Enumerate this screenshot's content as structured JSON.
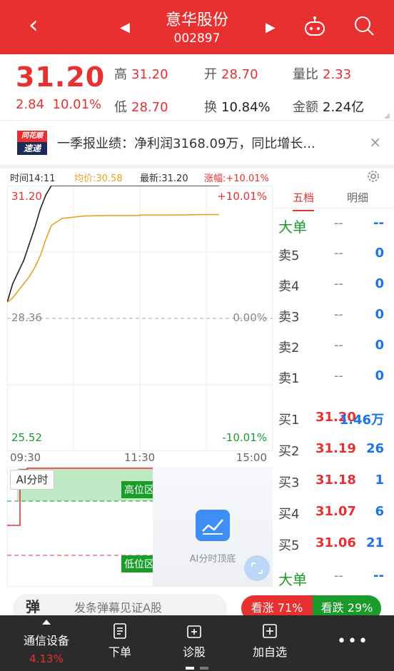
{
  "header": {
    "back_icon": "chevron-left-icon",
    "prev_icon": "triangle-left-icon",
    "next_icon": "triangle-right-icon",
    "stock_name": "意华股份",
    "stock_code": "002897",
    "robot_icon": "robot-icon",
    "search_icon": "search-icon",
    "bg_color": "#e93030"
  },
  "quote": {
    "price": "31.20",
    "change": "2.84",
    "change_pct": "10.01%",
    "high_label": "高",
    "high": "31.20",
    "open_label": "开",
    "open": "28.70",
    "vol_ratio_label": "量比",
    "vol_ratio": "2.33",
    "low_label": "低",
    "low": "28.70",
    "turnover_label": "换",
    "turnover": "10.84%",
    "amount_label": "金额",
    "amount": "2.24亿"
  },
  "news": {
    "logo_top": "同花顺",
    "logo_bottom": "速递",
    "text": "一季报业绩：净利润3168.09万，同比增长...",
    "close": "×"
  },
  "chart_info": {
    "time": "时间14:11",
    "avg": "均价:30.58",
    "latest": "最新:31.20",
    "change": "涨幅:+10.01%",
    "settings_icon": "gear-icon"
  },
  "chart_labels": {
    "top_price": "31.20",
    "top_pct": "+10.01%",
    "mid_price": "28.36",
    "mid_pct": "0.00%",
    "bottom_price": "25.52",
    "bottom_pct": "-10.01%",
    "t_start": "09:30",
    "t_mid": "11:30",
    "t_end": "15:00"
  },
  "chart_data": {
    "type": "line",
    "x": [
      "09:30",
      "09:35",
      "09:40",
      "09:45",
      "09:50",
      "09:55",
      "10:00",
      "10:05",
      "10:10",
      "10:20",
      "10:40",
      "11:00",
      "11:30",
      "13:00",
      "13:30",
      "14:00",
      "14:11"
    ],
    "series": [
      {
        "values": [
          28.7,
          29.1,
          29.35,
          29.6,
          29.95,
          30.3,
          30.7,
          31.0,
          31.2,
          31.2,
          31.2,
          31.2,
          31.2,
          31.2,
          31.2,
          31.2,
          31.2
        ]
      },
      {
        "values": [
          28.7,
          28.8,
          28.95,
          29.1,
          29.25,
          29.45,
          29.7,
          30.05,
          30.35,
          30.5,
          30.55,
          30.56,
          30.56,
          30.57,
          30.57,
          30.58,
          30.58
        ]
      }
    ],
    "ylim": [
      25.52,
      31.2
    ],
    "series_colors": [
      "#222222",
      "#e6a323"
    ]
  },
  "book": {
    "tab_depth": "五档",
    "tab_detail": "明细",
    "big_sell_label": "大单",
    "big_sell_p": "--",
    "big_sell_v": "--",
    "asks": [
      {
        "label": "卖5",
        "price": "--",
        "vol": "0"
      },
      {
        "label": "卖4",
        "price": "--",
        "vol": "0"
      },
      {
        "label": "卖3",
        "price": "--",
        "vol": "0"
      },
      {
        "label": "卖2",
        "price": "--",
        "vol": "0"
      },
      {
        "label": "卖1",
        "price": "--",
        "vol": "0"
      }
    ],
    "bids": [
      {
        "label": "买1",
        "price": "31.20",
        "vol": "1.46万"
      },
      {
        "label": "买2",
        "price": "31.19",
        "vol": "26"
      },
      {
        "label": "买3",
        "price": "31.18",
        "vol": "1"
      },
      {
        "label": "买4",
        "price": "31.07",
        "vol": "6"
      },
      {
        "label": "买5",
        "price": "31.06",
        "vol": "21"
      }
    ],
    "big_buy_label": "大单",
    "big_buy_p": "--",
    "big_buy_v": "--"
  },
  "ai": {
    "tag": "AI分时",
    "high_zone": "高位区",
    "low_zone": "低位区",
    "caption": "AI分时顶底",
    "chart_icon": "line-chart-icon",
    "expand_icon": "expand-icon"
  },
  "danmaku": {
    "icon_text": "弹",
    "placeholder": "发条弹幕见证A股",
    "up": "看涨 71%",
    "down": "看跌 29%"
  },
  "nav": {
    "sector_name": "通信设备",
    "sector_pct": "4.13%",
    "order": "下单",
    "diagnose": "诊股",
    "watchlist": "加自选",
    "more": "•••"
  }
}
